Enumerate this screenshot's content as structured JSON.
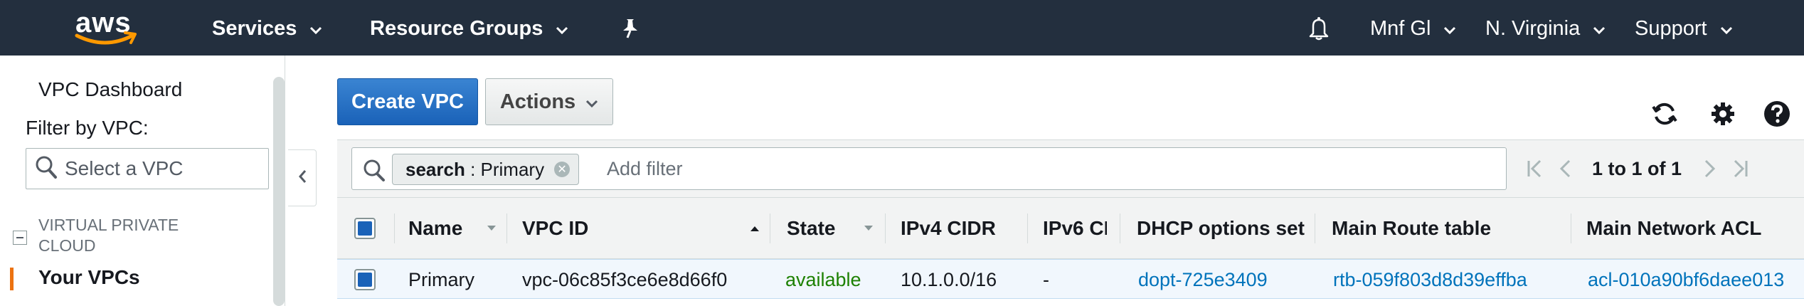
{
  "topnav": {
    "logo_text": "aws",
    "services": "Services",
    "resource_groups": "Resource Groups",
    "account": "Mnf Gl",
    "region": "N. Virginia",
    "support": "Support"
  },
  "sidebar": {
    "dashboard": "VPC Dashboard",
    "filter_label": "Filter by VPC:",
    "filter_placeholder": "Select a VPC",
    "section": "VIRTUAL PRIVATE CLOUD",
    "active_item": "Your VPCs"
  },
  "toolbar": {
    "create": "Create VPC",
    "actions": "Actions"
  },
  "filter": {
    "token_key": "search",
    "token_sep": " : ",
    "token_value": "Primary",
    "add_filter": "Add filter",
    "page_info": "1 to 1 of 1"
  },
  "table": {
    "headers": [
      "Name",
      "VPC ID",
      "State",
      "IPv4 CIDR",
      "IPv6 CI",
      "DHCP options set",
      "Main Route table",
      "Main Network ACL"
    ],
    "rows": [
      {
        "name": "Primary",
        "vpc_id": "vpc-06c85f3ce6e8d66f0",
        "state": "available",
        "ipv4": "10.1.0.0/16",
        "ipv6": "-",
        "dhcp": "dopt-725e3409",
        "route": "rtb-059f803d8d39effba",
        "acl": "acl-010a90bf6daee013"
      }
    ]
  },
  "colors": {
    "nav_bg": "#232f3e",
    "primary_button": "#1a62b8",
    "link": "#0073bb",
    "available": "#1d8102",
    "active_marker": "#ec7211"
  }
}
